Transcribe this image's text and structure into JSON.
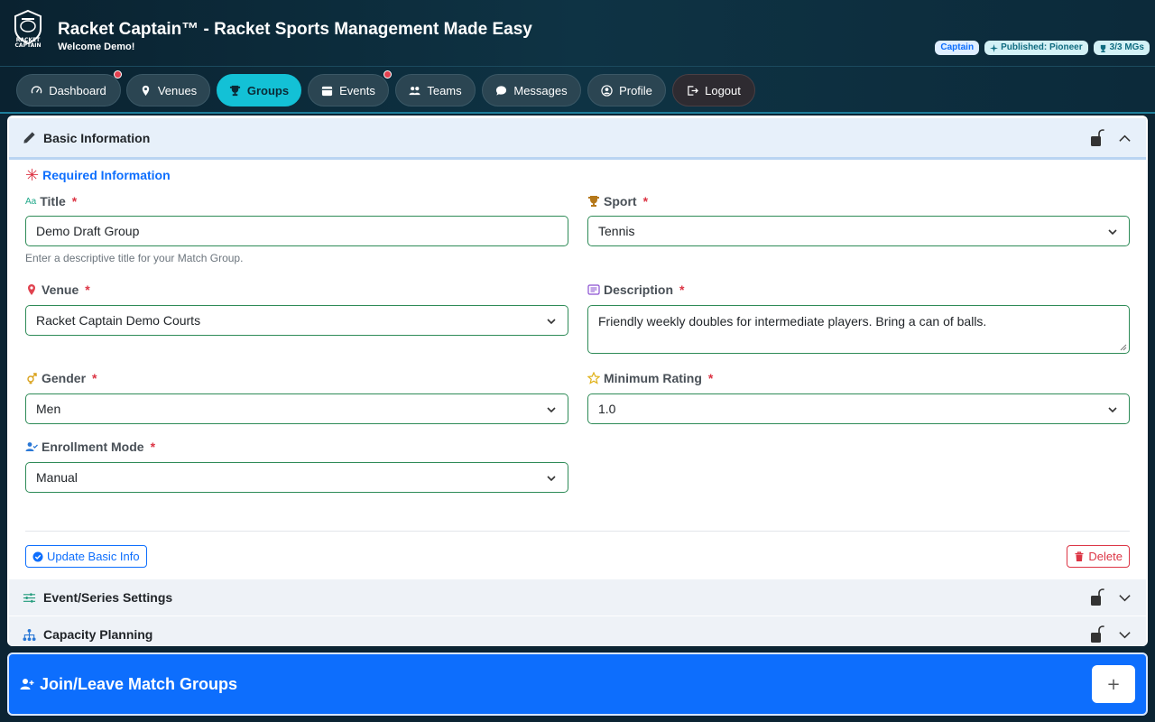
{
  "header": {
    "logo_text": "RACKET CAPTAIN",
    "title": "Racket Captain™ - Racket Sports Management Made Easy",
    "welcome": "Welcome Demo!",
    "badges": {
      "captain": "Captain",
      "published": "Published: Pioneer",
      "mgs": "3/3 MGs"
    }
  },
  "nav": {
    "items": [
      {
        "label": "Dashboard",
        "icon": "gauge-icon",
        "notification": true
      },
      {
        "label": "Venues",
        "icon": "location-pin-icon",
        "notification": false
      },
      {
        "label": "Groups",
        "icon": "trophy-icon",
        "notification": false,
        "active": true
      },
      {
        "label": "Events",
        "icon": "calendar-icon",
        "notification": true
      },
      {
        "label": "Teams",
        "icon": "people-icon",
        "notification": false
      },
      {
        "label": "Messages",
        "icon": "chat-bubble-icon",
        "notification": false
      },
      {
        "label": "Profile",
        "icon": "user-circle-icon",
        "notification": false
      },
      {
        "label": "Logout",
        "icon": "logout-icon",
        "notification": false
      }
    ]
  },
  "basic_info": {
    "title": "Basic Information",
    "required_heading": "Required Information",
    "fields": {
      "title": {
        "label": "Title",
        "value": "Demo Draft Group",
        "help": "Enter a descriptive title for your Match Group."
      },
      "sport": {
        "label": "Sport",
        "value": "Tennis"
      },
      "venue": {
        "label": "Venue",
        "value": "Racket Captain Demo Courts"
      },
      "description": {
        "label": "Description",
        "value": "Friendly weekly doubles for intermediate players. Bring a can of balls."
      },
      "gender": {
        "label": "Gender",
        "value": "Men"
      },
      "minimum_rating": {
        "label": "Minimum Rating",
        "value": "1.0"
      },
      "enrollment_mode": {
        "label": "Enrollment Mode",
        "value": "Manual"
      }
    },
    "required_marker": "*",
    "update_button": "Update Basic Info",
    "delete_button": "Delete"
  },
  "sections": {
    "event_series": "Event/Series Settings",
    "capacity": "Capacity Planning"
  },
  "join": {
    "title": "Join/Leave Match Groups",
    "plus": "+"
  },
  "colors": {
    "accent": "#13c1d6",
    "primary": "#0d6efd",
    "danger": "#dc3545",
    "field_border": "#2e8b57"
  }
}
